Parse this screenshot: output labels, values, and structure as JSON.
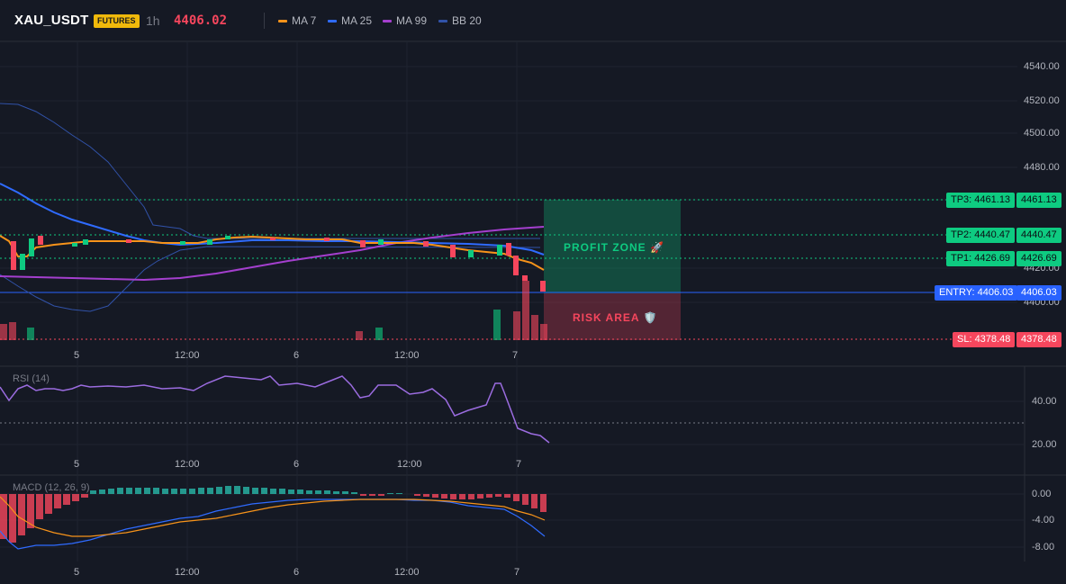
{
  "header": {
    "symbol": "XAU_USDT",
    "badge": "FUTURES",
    "timeframe": "1h",
    "last_price": "4406.02",
    "indicators": [
      {
        "label": "MA 7",
        "color": "#f7931a"
      },
      {
        "label": "MA 25",
        "color": "#2f6bff"
      },
      {
        "label": "MA 99",
        "color": "#a43fce"
      },
      {
        "label": "BB 20",
        "color": "#3152a8"
      }
    ]
  },
  "price_axis": [
    "4540.00",
    "4520.00",
    "4500.00",
    "4480.00",
    "4460.00",
    "4420.00",
    "4400.00"
  ],
  "time_axis": [
    "5",
    "12:00",
    "6",
    "12:00",
    "7"
  ],
  "levels": {
    "tp3": {
      "tag": "TP3: 4461.13",
      "value": "4461.13",
      "color": "#0ecb81"
    },
    "tp2": {
      "tag": "TP2: 4440.47",
      "value": "4440.47",
      "color": "#0ecb81"
    },
    "tp1": {
      "tag": "TP1: 4426.69",
      "value": "4426.69",
      "color": "#0ecb81"
    },
    "entry": {
      "tag": "ENTRY: 4406.03",
      "value": "4406.03",
      "color": "#2962ff"
    },
    "sl": {
      "tag": "SL: 4378.48",
      "value": "4378.48",
      "color": "#f6465d"
    }
  },
  "zones": {
    "profit": "PROFIT ZONE 🚀",
    "risk": "RISK AREA 🛡️"
  },
  "rsi": {
    "title": "RSI (14)",
    "axis": [
      "40.00",
      "20.00"
    ]
  },
  "macd": {
    "title": "MACD (12, 26, 9)",
    "axis": [
      "0.00",
      "-4.00",
      "-8.00"
    ]
  },
  "colors": {
    "background": "#151924",
    "up": "#0ecb81",
    "down": "#f6465d",
    "grid": "#1f2430"
  }
}
